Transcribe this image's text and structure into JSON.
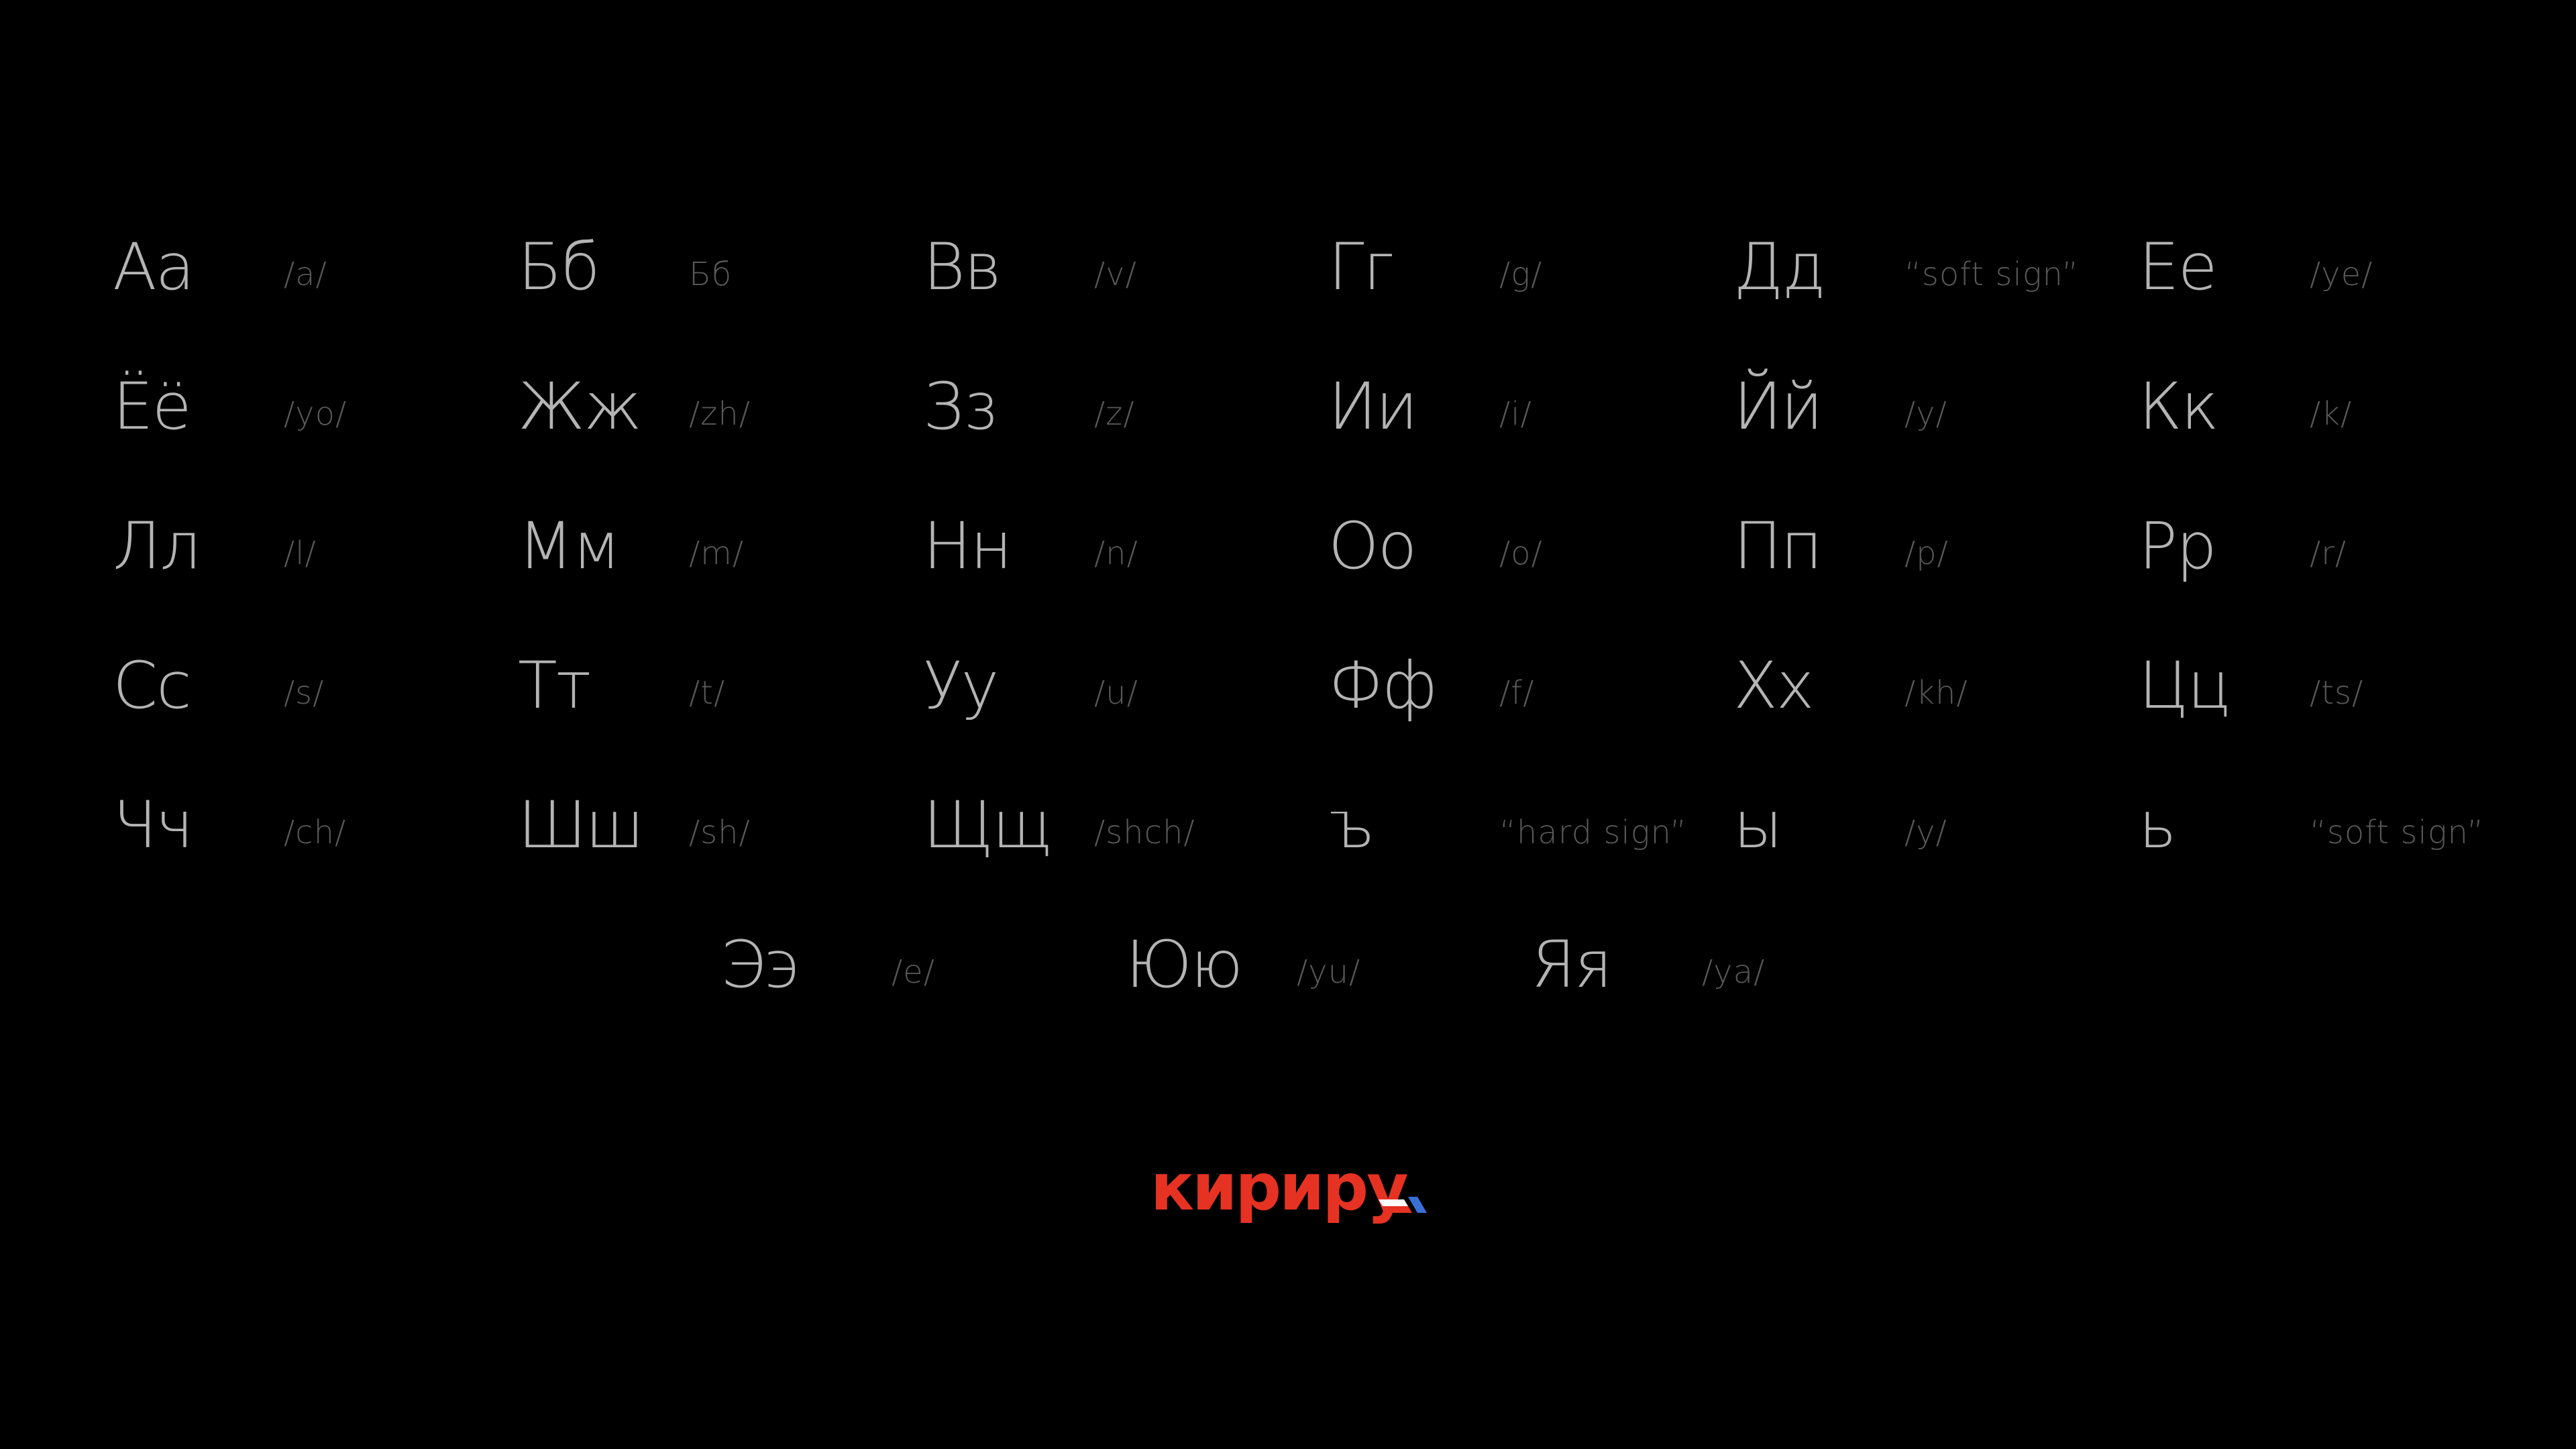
{
  "rows": [
    [
      {
        "letter": "Аа",
        "sound": "/a/"
      },
      {
        "letter": "Бб",
        "sound": "Бб"
      },
      {
        "letter": "Вв",
        "sound": "/v/"
      },
      {
        "letter": "Гг",
        "sound": "/g/"
      },
      {
        "letter": "Дд",
        "sound": "“soft sign”"
      },
      {
        "letter": "Ее",
        "sound": "/ye/"
      }
    ],
    [
      {
        "letter": "Ёё",
        "sound": "/yo/"
      },
      {
        "letter": "Жж",
        "sound": "/zh/"
      },
      {
        "letter": "Зз",
        "sound": "/z/"
      },
      {
        "letter": "Ии",
        "sound": "/i/"
      },
      {
        "letter": "Йй",
        "sound": "/y/"
      },
      {
        "letter": "Кк",
        "sound": "/k/"
      }
    ],
    [
      {
        "letter": "Лл",
        "sound": "/l/"
      },
      {
        "letter": "Мм",
        "sound": "/m/"
      },
      {
        "letter": "Нн",
        "sound": "/n/"
      },
      {
        "letter": "Оо",
        "sound": "/o/"
      },
      {
        "letter": "Пп",
        "sound": "/p/"
      },
      {
        "letter": "Рр",
        "sound": "/r/"
      }
    ],
    [
      {
        "letter": "Сс",
        "sound": "/s/"
      },
      {
        "letter": "Тт",
        "sound": "/t/"
      },
      {
        "letter": "Уу",
        "sound": "/u/"
      },
      {
        "letter": "Фф",
        "sound": "/f/"
      },
      {
        "letter": "Хх",
        "sound": "/kh/"
      },
      {
        "letter": "Цц",
        "sound": "/ts/"
      }
    ],
    [
      {
        "letter": "Чч",
        "sound": "/ch/"
      },
      {
        "letter": "Шш",
        "sound": "/sh/"
      },
      {
        "letter": "Щщ",
        "sound": "/shch/"
      },
      {
        "letter": "ъ",
        "sound": "“hard sign”"
      },
      {
        "letter": "ы",
        "sound": "/y/"
      },
      {
        "letter": "ь",
        "sound": "“soft sign”"
      }
    ],
    [
      {
        "letter": "Ээ",
        "sound": "/e/"
      },
      {
        "letter": "Юю",
        "sound": "/yu/"
      },
      {
        "letter": "Яя",
        "sound": "/ya/"
      }
    ]
  ],
  "logo": {
    "text": "кириру",
    "colors": {
      "text": "#e63223",
      "mark_white": "#ffffff",
      "mark_blue": "#3b6fd8",
      "mark_red": "#e63223"
    }
  },
  "colors": {
    "background": "#000000",
    "letter": "#b4b4b4",
    "sound": "#585858"
  }
}
